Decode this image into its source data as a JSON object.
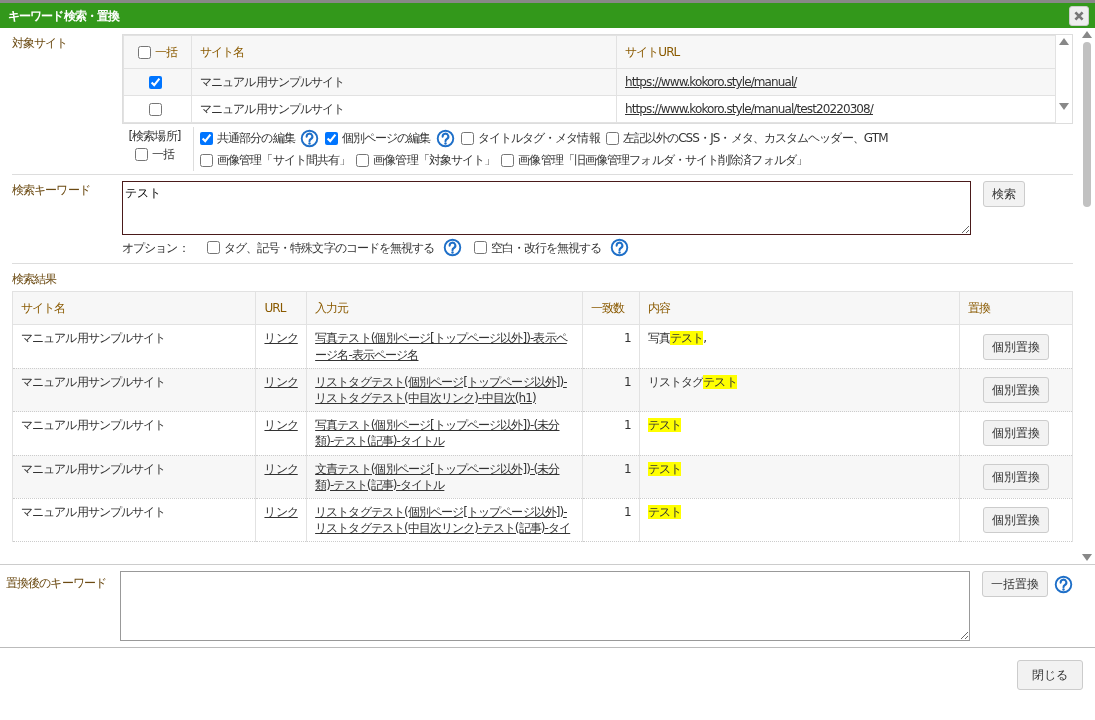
{
  "window": {
    "title": "キーワード検索・置換"
  },
  "target_sites": {
    "label": "対象サイト",
    "select_all": {
      "label": "一括",
      "checked": false
    },
    "columns": [
      "サイト名",
      "サイトURL"
    ],
    "rows": [
      {
        "name": "マニュアル用サンプルサイト",
        "url": "https://www.kokoro.style/manual/",
        "checked": true
      },
      {
        "name": "マニュアル用サンプルサイト",
        "url": "https://www.kokoro.style/manual/test20220308/",
        "checked": false
      }
    ]
  },
  "search_places": {
    "label": "[検索場所]",
    "select_all": {
      "label": "一括",
      "checked": false
    },
    "lines": [
      [
        {
          "label": "共通部分の編集",
          "checked": true,
          "help": true
        },
        {
          "label": "個別ページの編集",
          "checked": true,
          "help": true
        },
        {
          "label": "タイトルタグ・メタ情報",
          "checked": false,
          "help": false
        },
        {
          "label": "左記以外のCSS・JS・メタ、カスタムヘッダー、GTM",
          "checked": false,
          "help": false
        }
      ],
      [
        {
          "label": "画像管理「サイト間共有」",
          "checked": false,
          "help": false
        },
        {
          "label": "画像管理「対象サイト」",
          "checked": false,
          "help": false
        },
        {
          "label": "画像管理「旧画像管理フォルダ・サイト削除済フォルダ」",
          "checked": false,
          "help": false
        }
      ]
    ]
  },
  "search_keyword": {
    "label": "検索キーワード",
    "value": "テスト",
    "button": "検索"
  },
  "options": {
    "label": "オプション：",
    "items": [
      {
        "label": "タグ、記号・特殊文字のコードを無視する",
        "checked": false,
        "help": true
      },
      {
        "label": "空白・改行を無視する",
        "checked": false,
        "help": true
      }
    ]
  },
  "results": {
    "label": "検索結果",
    "columns": [
      "サイト名",
      "URL",
      "入力元",
      "一致数",
      "内容",
      "置換"
    ],
    "rows": [
      {
        "site": "マニュアル用サンプルサイト",
        "url": "リンク",
        "source": "写真テスト(個別ページ[トップページ以外])-表示ページ名-表示ページ名",
        "count": "1",
        "content": [
          {
            "text": "写真",
            "highlight": false
          },
          {
            "text": "テスト",
            "highlight": true
          },
          {
            "text": ",",
            "highlight": false
          }
        ],
        "button": "個別置換"
      },
      {
        "site": "マニュアル用サンプルサイト",
        "url": "リンク",
        "source": "リストタグテスト(個別ページ[トップページ以外])-リストタグテスト(中目次リンク)-中目次(h1)",
        "count": "1",
        "content": [
          {
            "text": "リストタグ",
            "highlight": false
          },
          {
            "text": "テスト",
            "highlight": true
          }
        ],
        "button": "個別置換"
      },
      {
        "site": "マニュアル用サンプルサイト",
        "url": "リンク",
        "source": "写真テスト(個別ページ[トップページ以外])-(未分類)-テスト(記事)-タイトル",
        "count": "1",
        "content": [
          {
            "text": "テスト",
            "highlight": true
          }
        ],
        "button": "個別置換"
      },
      {
        "site": "マニュアル用サンプルサイト",
        "url": "リンク",
        "source": "文責テスト(個別ページ[トップページ以外])-(未分類)-テスト(記事)-タイトル",
        "count": "1",
        "content": [
          {
            "text": "テスト",
            "highlight": true
          }
        ],
        "button": "個別置換"
      },
      {
        "site": "マニュアル用サンプルサイト",
        "url": "リンク",
        "source": "リストタグテスト(個別ページ[トップページ以外])-リストタグテスト(中目次リンク)-テスト(記事)-タイ",
        "count": "1",
        "content": [
          {
            "text": "テスト",
            "highlight": true
          }
        ],
        "button": "個別置換"
      }
    ]
  },
  "replace": {
    "label": "置換後のキーワード",
    "button": "一括置換",
    "help": true
  },
  "footer": {
    "close_button": "閉じる"
  }
}
